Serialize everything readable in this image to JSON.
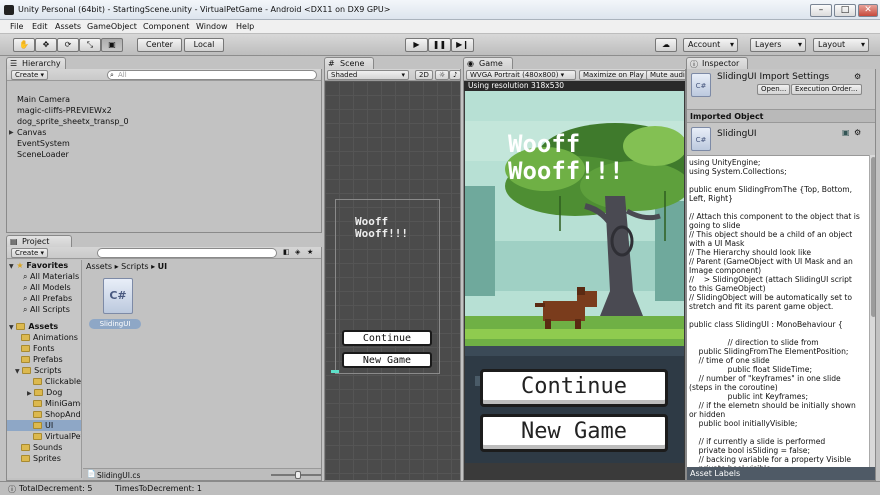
{
  "window": {
    "title": "Unity Personal (64bit) - StartingScene.unity - VirtualPetGame - Android <DX11 on DX9 GPU>",
    "min": "–",
    "max": "□",
    "close": "✕"
  },
  "menu": [
    "File",
    "Edit",
    "Assets",
    "GameObject",
    "Component",
    "Window",
    "Help"
  ],
  "toolbar": {
    "pivot": "Center",
    "space": "Local",
    "account": "Account",
    "layers": "Layers",
    "layout": "Layout"
  },
  "hierarchy": {
    "tab": "Hierarchy",
    "create": "Create",
    "search_placeholder": "All",
    "items": [
      "Main Camera",
      "magic-cliffs-PREVIEWx2",
      "dog_sprite_sheetx_transp_0",
      "Canvas",
      "EventSystem",
      "SceneLoader"
    ]
  },
  "project": {
    "tab": "Project",
    "create": "Create",
    "breadcrumb": [
      "Assets",
      "Scripts",
      "UI"
    ],
    "favorites_label": "Favorites",
    "favorites": [
      "All Materials",
      "All Models",
      "All Prefabs",
      "All Scripts"
    ],
    "assets_label": "Assets",
    "folders": [
      "Animations",
      "Fonts",
      "Prefabs",
      "Scripts",
      "Clickables",
      "Dog",
      "MiniGames",
      "ShopAndInventory",
      "UI",
      "VirtualPet",
      "Sounds",
      "Sprites"
    ],
    "asset_name": "SlidingUI",
    "asset_icon_label": "C#",
    "footer_file": "SlidingUI.cs"
  },
  "scene": {
    "tab": "Scene",
    "shading": "Shaded",
    "mode2d": "2D",
    "title_line1": "Wooff",
    "title_line2": "Wooff!!!",
    "btn_continue": "Continue",
    "btn_new": "New Game"
  },
  "game": {
    "tab": "Game",
    "resolution": "WVGA Portrait (480x800)",
    "maximize": "Maximize on Play",
    "mute": "Mute audio",
    "using_resolution": "Using resolution 318x530",
    "title_line1": "Wooff",
    "title_line2": "Wooff!!!",
    "btn_continue": "Continue",
    "btn_new": "New Game"
  },
  "inspector": {
    "tab": "Inspector",
    "heading": "SlidingUI Import Settings",
    "open": "Open...",
    "exec_order": "Execution Order...",
    "imported_object": "Imported Object",
    "object_name": "SlidingUI",
    "asset_labels": "Asset Labels",
    "code": [
      "using UnityEngine;",
      "using System.Collections;",
      "",
      "public enum SlidingFromThe {Top, Bottom,",
      "Left, Right}",
      "",
      "// Attach this component to the object that is",
      "going to slide",
      "// This object should be a child of an object",
      "with a UI Mask",
      "// The Hierarchy should look like",
      "// Parent (GameObject with UI Mask and an",
      "Image component)",
      "//    > SlidingObject (attach SlidingUI script",
      "to this GameObject)",
      "// SlidingObject will be automatically set to",
      "stretch and fit its parent game object.",
      "",
      "public class SlidingUI : MonoBehaviour {",
      "",
      "                // direction to slide from",
      "    public SlidingFromThe ElementPosition;",
      "    // time of one slide",
      "                public float SlideTime;",
      "    // number of \"keyframes\" in one slide",
      "(steps in the coroutine)",
      "                public int Keyframes;",
      "    // if the elemetn should be initially shown",
      "or hidden",
      "    public bool initiallyVisible;",
      "",
      "    // if currently a slide is performed",
      "    private bool isSliding = false;",
      "    // backing variable for a property Visible",
      "    private bool visible;"
    ]
  },
  "status": {
    "total": "TotalDecrement: 5",
    "times": "TimesToDecrement: 1"
  },
  "colors": {
    "selection": "#8ea7c6",
    "game_sky": "#b8e0d5",
    "scene_bg": "#4b4b4b",
    "folder": "#dcb94f"
  }
}
